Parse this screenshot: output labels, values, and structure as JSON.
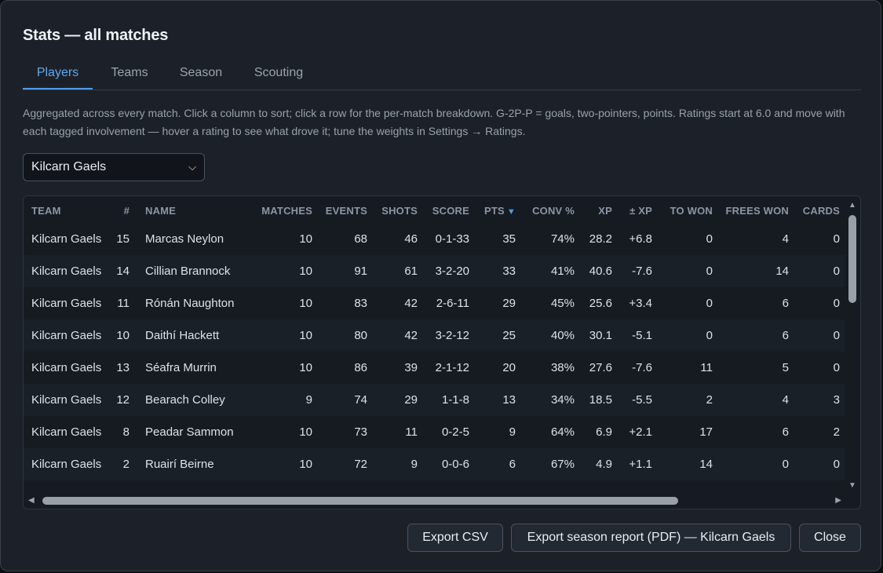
{
  "dialog": {
    "title": "Stats — all matches",
    "tabs": [
      {
        "label": "Players",
        "active": true
      },
      {
        "label": "Teams",
        "active": false
      },
      {
        "label": "Season",
        "active": false
      },
      {
        "label": "Scouting",
        "active": false
      }
    ],
    "description": "Aggregated across every match. Click a column to sort; click a row for the per-match breakdown. G-2P-P = goals, two-pointers, points. Ratings start at 6.0 and move with each tagged involvement — hover a rating to see what drove it; tune the weights in Settings → Ratings.",
    "team_filter": {
      "selected": "Kilcarn Gaels",
      "icon": "chevron-down-icon"
    }
  },
  "table": {
    "sorted_column": "PTS",
    "sort_icon": "sort-desc-icon",
    "columns": [
      "TEAM",
      "#",
      "NAME",
      "MATCHES",
      "EVENTS",
      "SHOTS",
      "SCORE",
      "PTS",
      "CONV %",
      "XP",
      "± XP",
      "TO WON",
      "FREES WON",
      "CARDS"
    ],
    "rows": [
      [
        "Kilcarn Gaels",
        "15",
        "Marcas Neylon",
        "10",
        "68",
        "46",
        "0-1-33",
        "35",
        "74%",
        "28.2",
        "+6.8",
        "0",
        "4",
        "0"
      ],
      [
        "Kilcarn Gaels",
        "14",
        "Cillian Brannock",
        "10",
        "91",
        "61",
        "3-2-20",
        "33",
        "41%",
        "40.6",
        "-7.6",
        "0",
        "14",
        "0"
      ],
      [
        "Kilcarn Gaels",
        "11",
        "Rónán Naughton",
        "10",
        "83",
        "42",
        "2-6-11",
        "29",
        "45%",
        "25.6",
        "+3.4",
        "0",
        "6",
        "0"
      ],
      [
        "Kilcarn Gaels",
        "10",
        "Daithí Hackett",
        "10",
        "80",
        "42",
        "3-2-12",
        "25",
        "40%",
        "30.1",
        "-5.1",
        "0",
        "6",
        "0"
      ],
      [
        "Kilcarn Gaels",
        "13",
        "Séafra Murrin",
        "10",
        "86",
        "39",
        "2-1-12",
        "20",
        "38%",
        "27.6",
        "-7.6",
        "11",
        "5",
        "0"
      ],
      [
        "Kilcarn Gaels",
        "12",
        "Bearach Colley",
        "9",
        "74",
        "29",
        "1-1-8",
        "13",
        "34%",
        "18.5",
        "-5.5",
        "2",
        "4",
        "3"
      ],
      [
        "Kilcarn Gaels",
        "8",
        "Peadar Sammon",
        "10",
        "73",
        "11",
        "0-2-5",
        "9",
        "64%",
        "6.9",
        "+2.1",
        "17",
        "6",
        "2"
      ],
      [
        "Kilcarn Gaels",
        "2",
        "Ruairí Beirne",
        "10",
        "72",
        "9",
        "0-0-6",
        "6",
        "67%",
        "4.9",
        "+1.1",
        "14",
        "0",
        "0"
      ]
    ],
    "scroll_icons": {
      "up": "scroll-up-icon",
      "down": "scroll-down-icon",
      "left": "scroll-left-icon",
      "right": "scroll-right-icon"
    }
  },
  "footer": {
    "export_csv": "Export CSV",
    "export_pdf": "Export season report (PDF) — Kilcarn Gaels",
    "close": "Close"
  }
}
